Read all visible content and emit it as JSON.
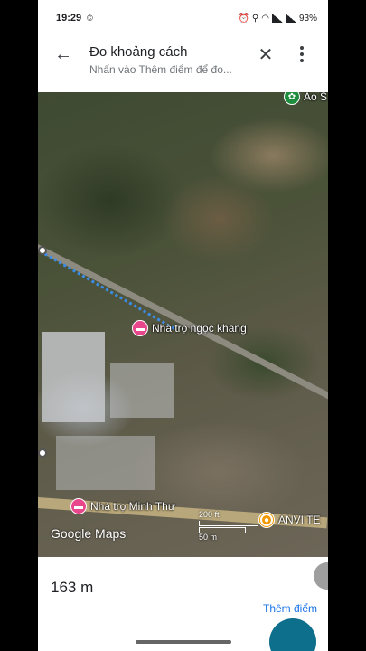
{
  "status_bar": {
    "time": "19:29",
    "battery": "93%"
  },
  "header": {
    "title": "Đo khoảng cách",
    "subtitle": "Nhấn vào Thêm điểm để đo..."
  },
  "map": {
    "pois": [
      {
        "label": "Ao S"
      },
      {
        "label": "Nhà trọ ngọc khang"
      },
      {
        "label": "Nhà trọ Minh Thư"
      },
      {
        "label": "ANVI TE"
      }
    ],
    "logo": "Google Maps",
    "scale_top": "200 ft",
    "scale_bottom": "50 m"
  },
  "panel": {
    "distance": "163 m",
    "add_point_label": "Thêm điểm"
  },
  "colors": {
    "accent": "#1a73e8",
    "poi_pink": "#e8478b",
    "measure_line": "#3b8de8"
  }
}
